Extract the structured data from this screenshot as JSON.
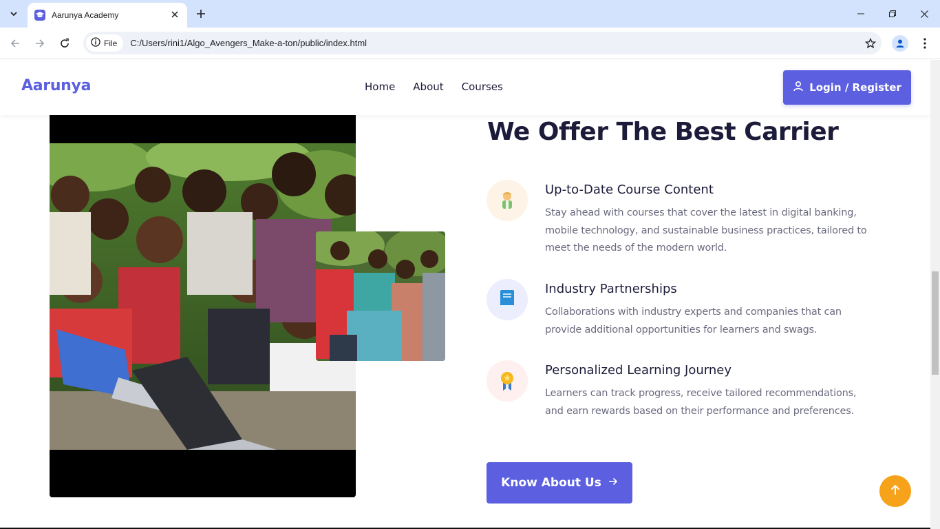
{
  "browser": {
    "tab_title": "Aarunya Academy",
    "chip_label": "File",
    "url": "C:/Users/rini1/Algo_Avengers_Make-a-ton/public/index.html",
    "icons": [
      "tab-search-icon",
      "close-icon",
      "plus-icon",
      "minimize-icon",
      "restore-icon",
      "close-window-icon",
      "back-icon",
      "forward-icon",
      "reload-icon",
      "info-icon",
      "star-icon",
      "profile-icon",
      "kebab-menu-icon"
    ]
  },
  "header": {
    "brand": "Aarunya",
    "nav": [
      "Home",
      "About",
      "Courses"
    ],
    "login_label": "Login / Register"
  },
  "main": {
    "headline": "We Offer The Best Carrier",
    "features": [
      {
        "icon": "student-icon",
        "title": "Up-to-Date Course Content",
        "desc": "Stay ahead with courses that cover the latest in digital banking, mobile technology, and sustainable business practices, tailored to meet the needs of the modern world."
      },
      {
        "icon": "book-icon",
        "title": "Industry Partnerships",
        "desc": "Collaborations with industry experts and companies that can provide additional opportunities for learners and swags."
      },
      {
        "icon": "medal-icon",
        "title": "Personalized Learning Journey",
        "desc": "Learners can track progress, receive tailored recommendations, and earn rewards based on their performance and preferences."
      }
    ],
    "cta_label": "Know About Us"
  },
  "colors": {
    "accent": "#5b5fe0",
    "heading": "#1c1c3a",
    "body_text": "#6b6b80",
    "scroll_top": "#f7a21b",
    "tab_strip": "#d3e3fd"
  }
}
